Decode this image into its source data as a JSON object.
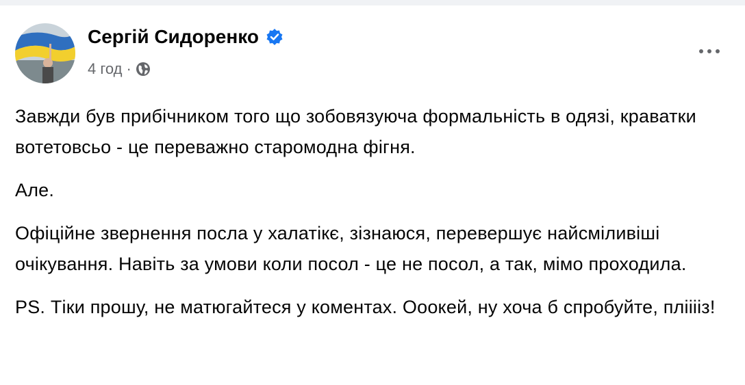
{
  "post": {
    "author": "Сергій Сидоренко",
    "verified": true,
    "timestamp": "4 год",
    "separator": "·",
    "privacy_icon": "globe-icon",
    "more_icon": "more-options-icon",
    "paragraphs": [
      "Завжди був прибічником того що зобовязуюча формальність в одязі, краватки вотетовсьо - це переважно старомодна фігня.",
      "Але.",
      "Офіційне звернення посла у халатікє, зізнаюся, перевершує найсміливіші очікування. Навіть за умови коли посол - це не посол, а так, мімо проходила.",
      "PS. Тіки прошу, не матюгайтеся у коментах. Ооокей, ну хоча б спробуйте, плііііз!"
    ]
  },
  "colors": {
    "accent": "#1877f2",
    "text": "#050505",
    "secondary": "#65676b"
  }
}
